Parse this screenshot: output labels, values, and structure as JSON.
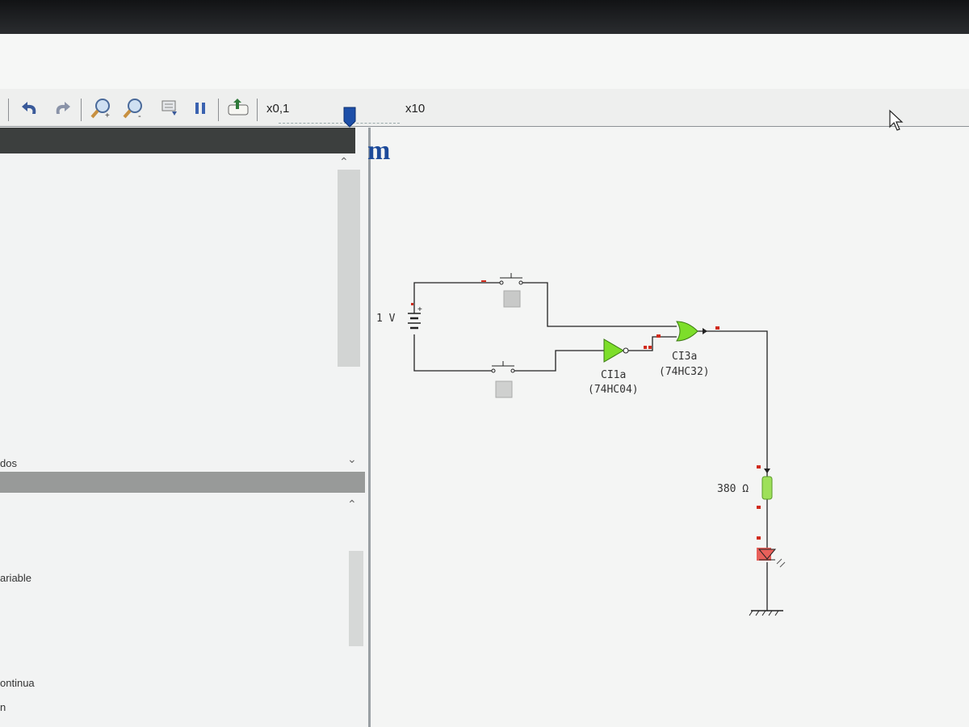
{
  "toolbar": {
    "undo_icon": "undo-arrow",
    "redo_icon": "redo-arrow",
    "zoom_in_icon": "magnifier-plus",
    "zoom_out_icon": "magnifier-minus",
    "pause_icon": "pause-bars",
    "speed_min_label": "x0,1",
    "speed_max_label": "x10"
  },
  "left_panel": {
    "label_1": "dos",
    "label_2": "ariable",
    "label_3": "ontinua",
    "label_4": "n"
  },
  "canvas": {
    "app_logo": "m",
    "battery_label": "1 V",
    "inverter_name": "CI1a",
    "inverter_part": "(74HC04)",
    "or_gate_name": "CI3a",
    "or_gate_part": "(74HC32)",
    "resistor_label": "380 Ω"
  },
  "colors": {
    "gate_fill": "#7dde2a",
    "resistor_fill": "#9ee05a",
    "led_fill": "#e8605a",
    "wire": "#222222",
    "pin_marker": "#d02b1c",
    "slider_thumb": "#1d4fa8"
  }
}
